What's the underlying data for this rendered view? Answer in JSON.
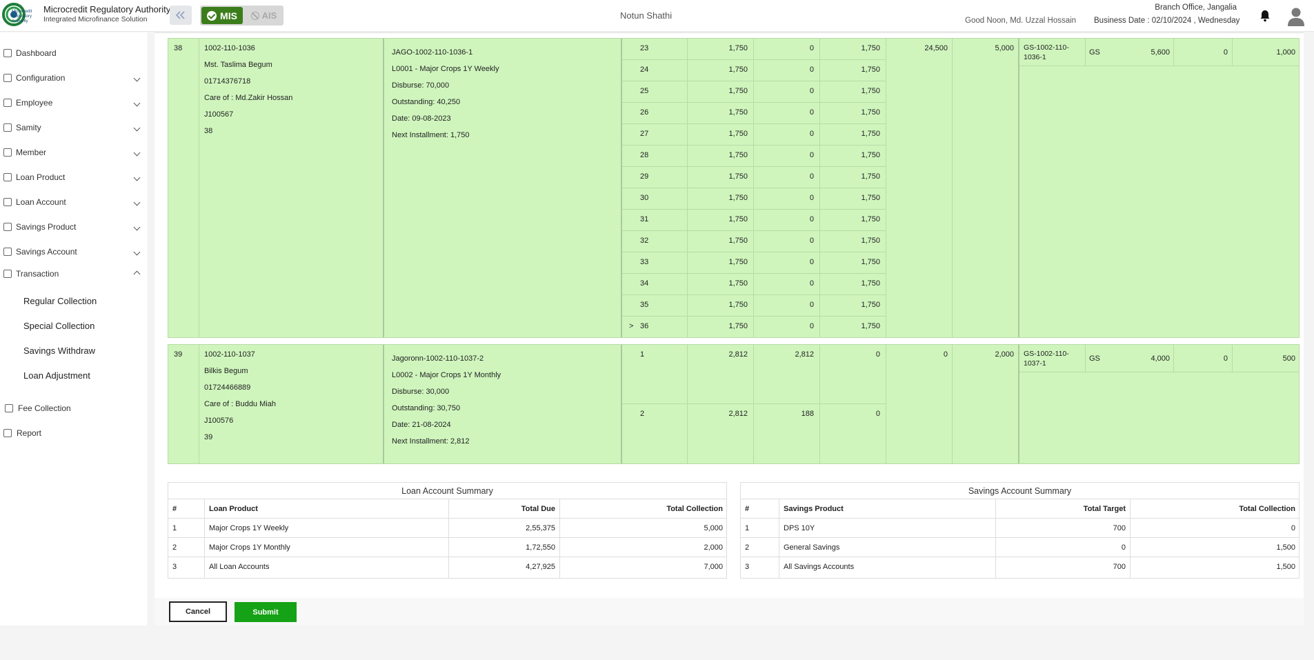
{
  "header": {
    "org_name": "Microcredit Regulatory Authority",
    "org_sub": "Integrated Microfinance Solution",
    "logo_text": "Microcredit Regulatory Authority",
    "mis_label": "MIS",
    "ais_label": "AIS",
    "center_title": "Notun Shathi",
    "branch": "Branch Office, Jangalia",
    "greeting": "Good Noon, Md. Uzzal Hossain",
    "business_date": "Business Date : 02/10/2024 , Wednesday"
  },
  "sidebar": {
    "items": [
      {
        "label": "Dashboard"
      },
      {
        "label": "Configuration"
      },
      {
        "label": "Employee"
      },
      {
        "label": "Samity"
      },
      {
        "label": "Member"
      },
      {
        "label": "Loan Product"
      },
      {
        "label": "Loan Account"
      },
      {
        "label": "Savings Product"
      },
      {
        "label": "Savings Account"
      },
      {
        "label": "Transaction"
      }
    ],
    "sub_items": [
      {
        "label": "Regular Collection"
      },
      {
        "label": "Special Collection"
      },
      {
        "label": "Savings Withdraw"
      },
      {
        "label": "Loan Adjustment"
      }
    ],
    "extra": [
      {
        "label": "Fee Collection"
      },
      {
        "label": "Report"
      }
    ]
  },
  "groups": [
    {
      "sl": "38",
      "member": [
        "1002-110-1036",
        "Mst. Taslima Begum",
        "01714376718",
        "Care of : Md.Zakir Hossan",
        "J100567",
        "38"
      ],
      "loan": [
        "JAGO-1002-110-1036-1",
        "L0001 - Major Crops 1Y Weekly",
        "Disburse: 70,000",
        "Outstanding: 40,250",
        "Date: 09-08-2023",
        "Next Installment: 1,750"
      ],
      "installments": [
        {
          "no": "23",
          "amount": "1,750",
          "paid": "0",
          "due": "1,750"
        },
        {
          "no": "24",
          "amount": "1,750",
          "paid": "0",
          "due": "1,750"
        },
        {
          "no": "25",
          "amount": "1,750",
          "paid": "0",
          "due": "1,750"
        },
        {
          "no": "26",
          "amount": "1,750",
          "paid": "0",
          "due": "1,750"
        },
        {
          "no": "27",
          "amount": "1,750",
          "paid": "0",
          "due": "1,750"
        },
        {
          "no": "28",
          "amount": "1,750",
          "paid": "0",
          "due": "1,750"
        },
        {
          "no": "29",
          "amount": "1,750",
          "paid": "0",
          "due": "1,750"
        },
        {
          "no": "30",
          "amount": "1,750",
          "paid": "0",
          "due": "1,750"
        },
        {
          "no": "31",
          "amount": "1,750",
          "paid": "0",
          "due": "1,750"
        },
        {
          "no": "32",
          "amount": "1,750",
          "paid": "0",
          "due": "1,750"
        },
        {
          "no": "33",
          "amount": "1,750",
          "paid": "0",
          "due": "1,750"
        },
        {
          "no": "34",
          "amount": "1,750",
          "paid": "0",
          "due": "1,750"
        },
        {
          "no": "35",
          "amount": "1,750",
          "paid": "0",
          "due": "1,750"
        },
        {
          "no": "36",
          "amount": "1,750",
          "paid": "0",
          "due": "1,750",
          "marker": ">"
        }
      ],
      "total_due": "24,500",
      "collection": "5,000",
      "savings": {
        "account": [
          "GS-1002-110-",
          "1036-1"
        ],
        "product": "GS",
        "target": "5,600",
        "withdraw": "0",
        "collection": "1,000"
      }
    },
    {
      "sl": "39",
      "member": [
        "1002-110-1037",
        "Bilkis Begum",
        "01724466889",
        "Care of : Buddu Miah",
        "J100576",
        "39"
      ],
      "loan": [
        "Jagoronn-1002-110-1037-2",
        "L0002 - Major Crops 1Y Monthly",
        "Disburse: 30,000",
        "Outstanding: 30,750",
        "Date: 21-08-2024",
        "Next Installment: 2,812"
      ],
      "installments": [
        {
          "no": "1",
          "amount": "2,812",
          "paid": "2,812",
          "due": "0"
        },
        {
          "no": "2",
          "amount": "2,812",
          "paid": "188",
          "due": "0"
        }
      ],
      "total_due": "0",
      "collection": "2,000",
      "savings": {
        "account": [
          "GS-1002-110-",
          "1037-1"
        ],
        "product": "GS",
        "target": "4,000",
        "withdraw": "0",
        "collection": "500"
      }
    }
  ],
  "loan_summary": {
    "title": "Loan Account Summary",
    "headers": [
      "#",
      "Loan Product",
      "Total Due",
      "Total Collection"
    ],
    "rows": [
      [
        "1",
        "Major Crops 1Y Weekly",
        "2,55,375",
        "5,000"
      ],
      [
        "2",
        "Major Crops 1Y Monthly",
        "1,72,550",
        "2,000"
      ],
      [
        "3",
        "All Loan Accounts",
        "4,27,925",
        "7,000"
      ]
    ]
  },
  "savings_summary": {
    "title": "Savings Account Summary",
    "headers": [
      "#",
      "Savings Product",
      "Total Target",
      "Total Collection"
    ],
    "rows": [
      [
        "1",
        "DPS 10Y",
        "700",
        "0"
      ],
      [
        "2",
        "General Savings",
        "0",
        "1,500"
      ],
      [
        "3",
        "All Savings Accounts",
        "700",
        "1,500"
      ]
    ]
  },
  "actions": {
    "cancel": "Cancel",
    "submit": "Submit"
  },
  "colors": {
    "row_green": "#cff5bd",
    "mis_green": "#3b7d1b",
    "submit_green": "#16a216"
  }
}
